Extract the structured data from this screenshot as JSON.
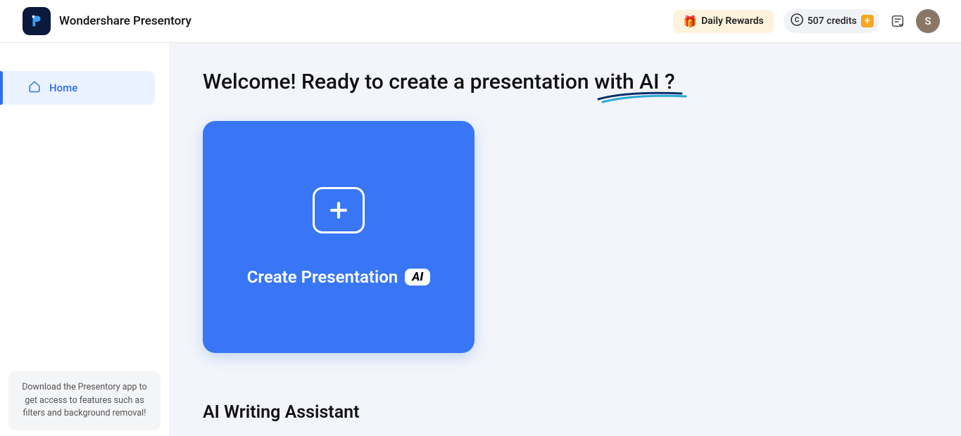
{
  "header": {
    "brand_name": "Wondershare Presentory",
    "rewards_label": "Daily Rewards",
    "credits_value": "507 credits",
    "avatar_initial": "S"
  },
  "sidebar": {
    "items": [
      {
        "label": "Home"
      }
    ],
    "promo_text": "Download the Presentory app to get access to features such as filters and background removal!"
  },
  "main": {
    "welcome_prefix": "Welcome! Ready to create a presentation ",
    "welcome_highlight": "with AI",
    "welcome_suffix": " ?",
    "create_label": "Create Presentation",
    "ai_badge": "AI",
    "section_heading": "AI Writing Assistant"
  }
}
